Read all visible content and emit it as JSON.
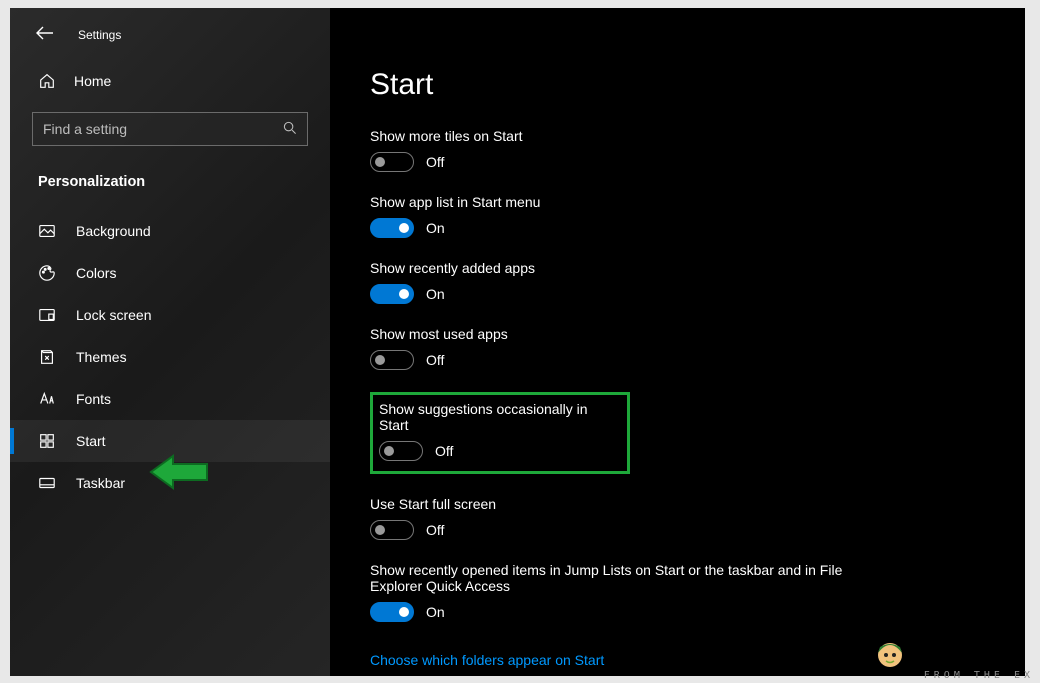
{
  "app_title": "Settings",
  "sidebar": {
    "home_label": "Home",
    "section_title": "Personalization",
    "items": [
      {
        "label": "Background"
      },
      {
        "label": "Colors"
      },
      {
        "label": "Lock screen"
      },
      {
        "label": "Themes"
      },
      {
        "label": "Fonts"
      },
      {
        "label": "Start"
      },
      {
        "label": "Taskbar"
      }
    ]
  },
  "search": {
    "placeholder": "Find a setting"
  },
  "page": {
    "title": "Start",
    "settings": [
      {
        "label": "Show more tiles on Start",
        "on": false,
        "state": "Off"
      },
      {
        "label": "Show app list in Start menu",
        "on": true,
        "state": "On"
      },
      {
        "label": "Show recently added apps",
        "on": true,
        "state": "On"
      },
      {
        "label": "Show most used apps",
        "on": false,
        "state": "Off"
      },
      {
        "label": "Show suggestions occasionally in Start",
        "on": false,
        "state": "Off"
      },
      {
        "label": "Use Start full screen",
        "on": false,
        "state": "Off"
      },
      {
        "label": "Show recently opened items in Jump Lists on Start or the taskbar and in File Explorer Quick Access",
        "on": true,
        "state": "On"
      }
    ],
    "link": "Choose which folders appear on Start"
  },
  "watermark": "FROM THE EX"
}
